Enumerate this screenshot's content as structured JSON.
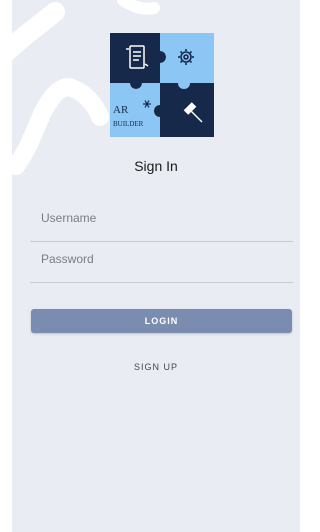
{
  "logo": {
    "line1": "AR",
    "line2": "BUILDER",
    "icons": [
      "document-icon",
      "gear-icon",
      "snowflake-icon",
      "hammer-icon"
    ],
    "colors": {
      "dark": "#16294b",
      "light": "#8cc6f4"
    }
  },
  "page": {
    "title": "Sign In"
  },
  "form": {
    "username_placeholder": "Username",
    "password_placeholder": "Password",
    "login_label": "LOGIN",
    "signup_label": "SIGN UP"
  },
  "colors": {
    "background": "#e9ecf2",
    "button": "#7a8cb0",
    "divider": "#c7cad1"
  }
}
